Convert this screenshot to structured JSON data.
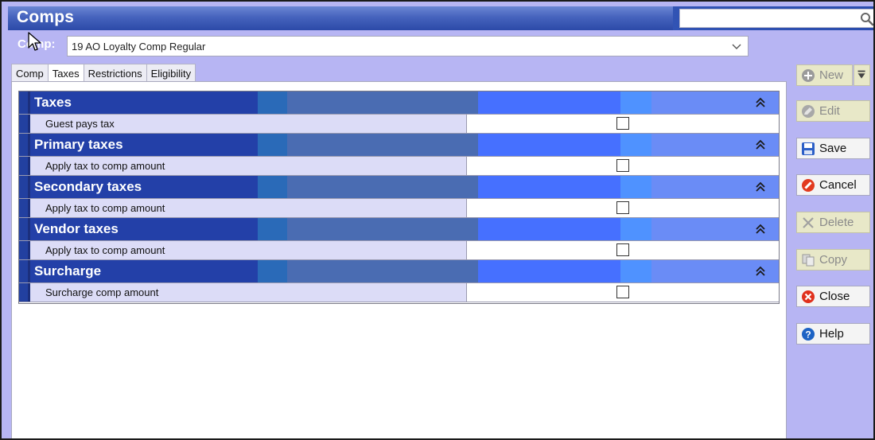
{
  "window": {
    "title": "Comps"
  },
  "search": {
    "value": "",
    "placeholder": ""
  },
  "comp_selector": {
    "label": "Comp:",
    "selected": "19 AO Loyalty Comp Regular"
  },
  "tabs": [
    {
      "label": "Comp",
      "active": false
    },
    {
      "label": "Taxes",
      "active": true
    },
    {
      "label": "Restrictions",
      "active": false
    },
    {
      "label": "Eligibility",
      "active": false
    }
  ],
  "sections": [
    {
      "title": "Taxes",
      "row": {
        "label": "Guest pays tax",
        "checked": false
      }
    },
    {
      "title": "Primary taxes",
      "row": {
        "label": "Apply tax to comp amount",
        "checked": false
      }
    },
    {
      "title": "Secondary taxes",
      "row": {
        "label": "Apply tax to comp amount",
        "checked": false
      }
    },
    {
      "title": "Vendor taxes",
      "row": {
        "label": "Apply tax to comp amount",
        "checked": false
      }
    },
    {
      "title": "Surcharge",
      "row": {
        "label": "Surcharge comp amount",
        "checked": false
      }
    }
  ],
  "buttons": {
    "new": {
      "label": "New",
      "enabled": false,
      "icon": "plus-circle-icon"
    },
    "edit": {
      "label": "Edit",
      "enabled": false,
      "icon": "pencil-icon"
    },
    "save": {
      "label": "Save",
      "enabled": true,
      "icon": "floppy-disk-icon"
    },
    "cancel": {
      "label": "Cancel",
      "enabled": true,
      "icon": "no-entry-icon"
    },
    "delete": {
      "label": "Delete",
      "enabled": false,
      "icon": "x-icon"
    },
    "copy": {
      "label": "Copy",
      "enabled": false,
      "icon": "copy-icon"
    },
    "close": {
      "label": "Close",
      "enabled": true,
      "icon": "close-circle-icon"
    },
    "help": {
      "label": "Help",
      "enabled": true,
      "icon": "question-circle-icon"
    }
  },
  "colors": {
    "title_bar": "#3d5fc0",
    "section_header": "#2340a8",
    "row_label_bg": "#dcdcf7",
    "frame_bg": "#b7b5f3",
    "disabled_button": "#e8e8c8"
  }
}
